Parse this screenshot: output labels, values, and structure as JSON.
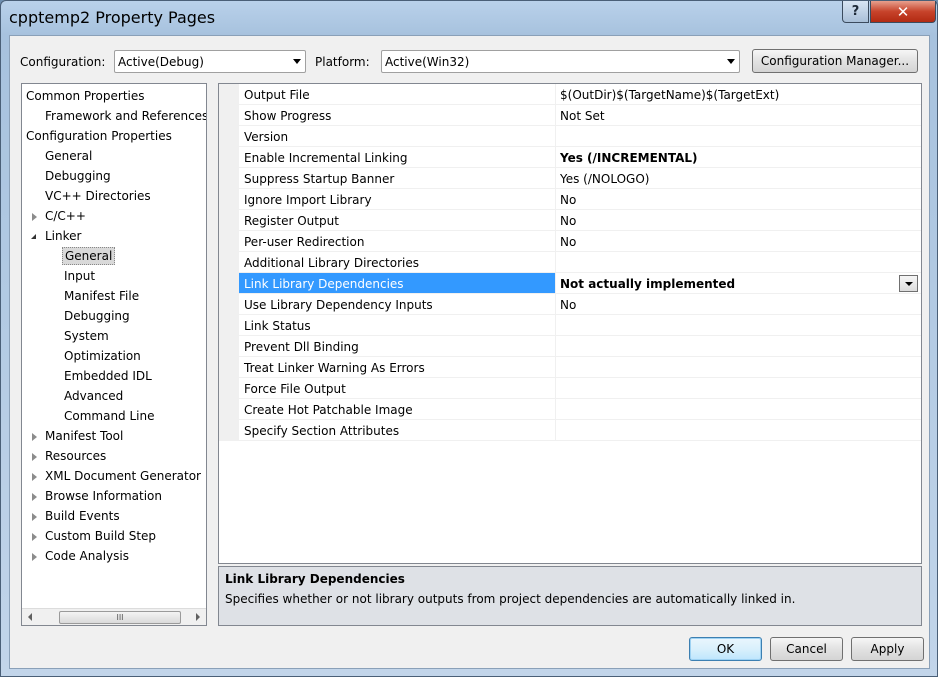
{
  "window": {
    "title": "cpptemp2 Property Pages",
    "help_label": "?",
    "close_label": "✕"
  },
  "config": {
    "configuration_label": "Configuration:",
    "configuration_value": "Active(Debug)",
    "platform_label": "Platform:",
    "platform_value": "Active(Win32)",
    "manager_button": "Configuration Manager..."
  },
  "tree": {
    "items": [
      {
        "label": "Common Properties"
      },
      {
        "label": "Framework and References"
      },
      {
        "label": "Configuration Properties"
      },
      {
        "label": "General"
      },
      {
        "label": "Debugging"
      },
      {
        "label": "VC++ Directories"
      },
      {
        "label": "C/C++"
      },
      {
        "label": "Linker"
      },
      {
        "label": "General"
      },
      {
        "label": "Input"
      },
      {
        "label": "Manifest File"
      },
      {
        "label": "Debugging"
      },
      {
        "label": "System"
      },
      {
        "label": "Optimization"
      },
      {
        "label": "Embedded IDL"
      },
      {
        "label": "Advanced"
      },
      {
        "label": "Command Line"
      },
      {
        "label": "Manifest Tool"
      },
      {
        "label": "Resources"
      },
      {
        "label": "XML Document Generator"
      },
      {
        "label": "Browse Information"
      },
      {
        "label": "Build Events"
      },
      {
        "label": "Custom Build Step"
      },
      {
        "label": "Code Analysis"
      }
    ],
    "scroll_thumb_glyph": "III"
  },
  "grid": {
    "rows": [
      {
        "name": "Output File",
        "value": "$(OutDir)$(TargetName)$(TargetExt)"
      },
      {
        "name": "Show Progress",
        "value": "Not Set"
      },
      {
        "name": "Version",
        "value": ""
      },
      {
        "name": "Enable Incremental Linking",
        "value": "Yes (/INCREMENTAL)"
      },
      {
        "name": "Suppress Startup Banner",
        "value": "Yes (/NOLOGO)"
      },
      {
        "name": "Ignore Import Library",
        "value": "No"
      },
      {
        "name": "Register Output",
        "value": "No"
      },
      {
        "name": "Per-user Redirection",
        "value": "No"
      },
      {
        "name": "Additional Library Directories",
        "value": ""
      },
      {
        "name": "Link Library Dependencies",
        "value": "Not actually implemented"
      },
      {
        "name": "Use Library Dependency Inputs",
        "value": "No"
      },
      {
        "name": "Link Status",
        "value": ""
      },
      {
        "name": "Prevent Dll Binding",
        "value": ""
      },
      {
        "name": "Treat Linker Warning As Errors",
        "value": ""
      },
      {
        "name": "Force File Output",
        "value": ""
      },
      {
        "name": "Create Hot Patchable Image",
        "value": ""
      },
      {
        "name": "Specify Section Attributes",
        "value": ""
      }
    ]
  },
  "description": {
    "title": "Link Library Dependencies",
    "body": "Specifies whether or not library outputs from project dependencies are automatically linked in."
  },
  "buttons": {
    "ok": "OK",
    "cancel": "Cancel",
    "apply": "Apply"
  }
}
